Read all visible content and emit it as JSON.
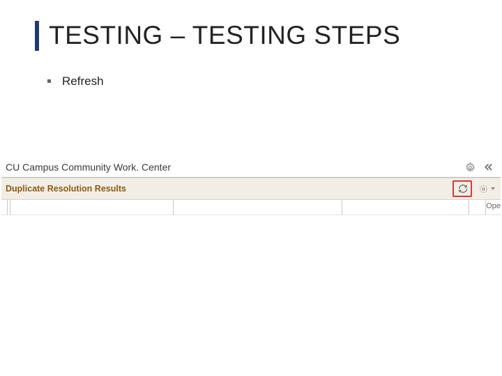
{
  "title": "TESTING – TESTING STEPS",
  "bullets": [
    "Refresh"
  ],
  "ui": {
    "workcenter_title": "CU Campus Community Work. Center",
    "section_title": "Duplicate Resolution Results",
    "truncated_right_label": "Ope"
  }
}
